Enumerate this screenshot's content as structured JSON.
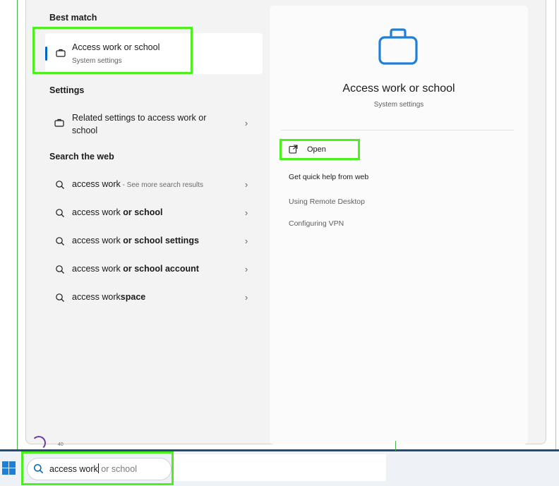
{
  "search_flyout": {
    "best_match_header": "Best match",
    "best_match": {
      "title": "Access work or school",
      "subtitle": "System settings",
      "icon": "briefcase-icon"
    },
    "settings_header": "Settings",
    "settings_item": {
      "label": "Related settings to access work or school",
      "icon": "briefcase-icon"
    },
    "web_header": "Search the web",
    "web_results": [
      {
        "prefix": "access work",
        "bold": "",
        "hint": " - See more search results"
      },
      {
        "prefix": "access work ",
        "bold": "or school",
        "hint": ""
      },
      {
        "prefix": "access work ",
        "bold": "or school settings",
        "hint": ""
      },
      {
        "prefix": "access work ",
        "bold": "or school account",
        "hint": ""
      },
      {
        "prefix": "access work",
        "bold": "space",
        "hint": ""
      }
    ],
    "avatar_count": "40"
  },
  "detail_pane": {
    "title": "Access work or school",
    "subtitle": "System settings",
    "open_label": "Open",
    "quick_help_label": "Get quick help from web",
    "help_links": [
      "Using Remote Desktop",
      "Configuring VPN"
    ]
  },
  "taskbar": {
    "search_typed": "access work",
    "search_suggestion": " or school"
  },
  "colors": {
    "accent": "#0067c0",
    "highlight": "#4cf01e",
    "icon_blue": "#1e7fd8"
  }
}
